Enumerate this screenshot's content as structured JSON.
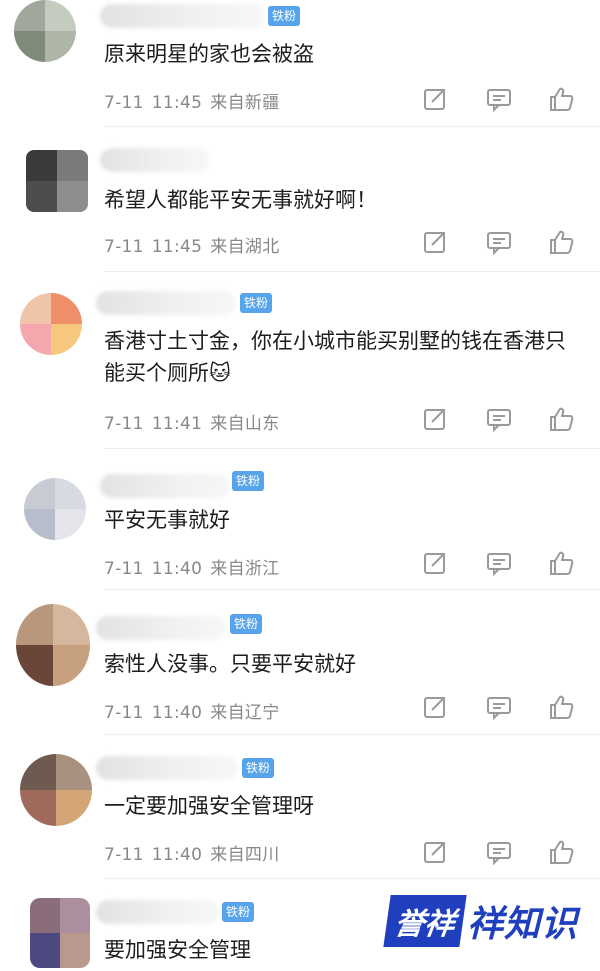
{
  "comments": [
    {
      "text": "原来明星的家也会被盗",
      "date": "7-11",
      "time": "11:45",
      "location": "来自新疆",
      "badge": "铁粉",
      "avatar_colors": [
        "#9fa89a",
        "#c4cbbf",
        "#7f8a78",
        "#aeb6a8"
      ]
    },
    {
      "text": "希望人都能平安无事就好啊！",
      "date": "7-11",
      "time": "11:45",
      "location": "来自湖北",
      "badge": "",
      "avatar_colors": [
        "#3a3a3a",
        "#7a7a7a",
        "#4d4d4d",
        "#8d8d8d"
      ]
    },
    {
      "text": "香港寸土寸金，你在小城市能买别墅的钱在香港只能买个厕所🐱",
      "date": "7-11",
      "time": "11:41",
      "location": "来自山东",
      "badge": "铁粉",
      "avatar_colors": [
        "#f0c4a8",
        "#f08e6a",
        "#f5a7ae",
        "#f7c77e"
      ]
    },
    {
      "text": "平安无事就好",
      "date": "7-11",
      "time": "11:40",
      "location": "来自浙江",
      "badge": "铁粉",
      "avatar_colors": [
        "#c9cbd4",
        "#d7dae0",
        "#b7bdcb",
        "#e3e5ea"
      ]
    },
    {
      "text": "索性人没事。只要平安就好",
      "date": "7-11",
      "time": "11:40",
      "location": "来自辽宁",
      "badge": "铁粉",
      "avatar_colors": [
        "#b9977c",
        "#d4b79c",
        "#6a4638",
        "#c6a07e"
      ]
    },
    {
      "text": "一定要加强安全管理呀",
      "date": "7-11",
      "time": "11:40",
      "location": "来自四川",
      "badge": "铁粉",
      "avatar_colors": [
        "#6e5a50",
        "#a8927f",
        "#a06a5a",
        "#d3a577"
      ]
    },
    {
      "text": "要加强安全管理",
      "date": "",
      "time": "",
      "location": "",
      "badge": "铁粉",
      "avatar_colors": [
        "#8b6c7b",
        "#ab8f9e",
        "#4d4a82",
        "#b79a8d"
      ]
    }
  ],
  "icons": {
    "share": "share-icon",
    "comment": "comment-icon",
    "like": "like-icon"
  },
  "watermark": {
    "box": "誉祥",
    "text": "祥知识"
  }
}
